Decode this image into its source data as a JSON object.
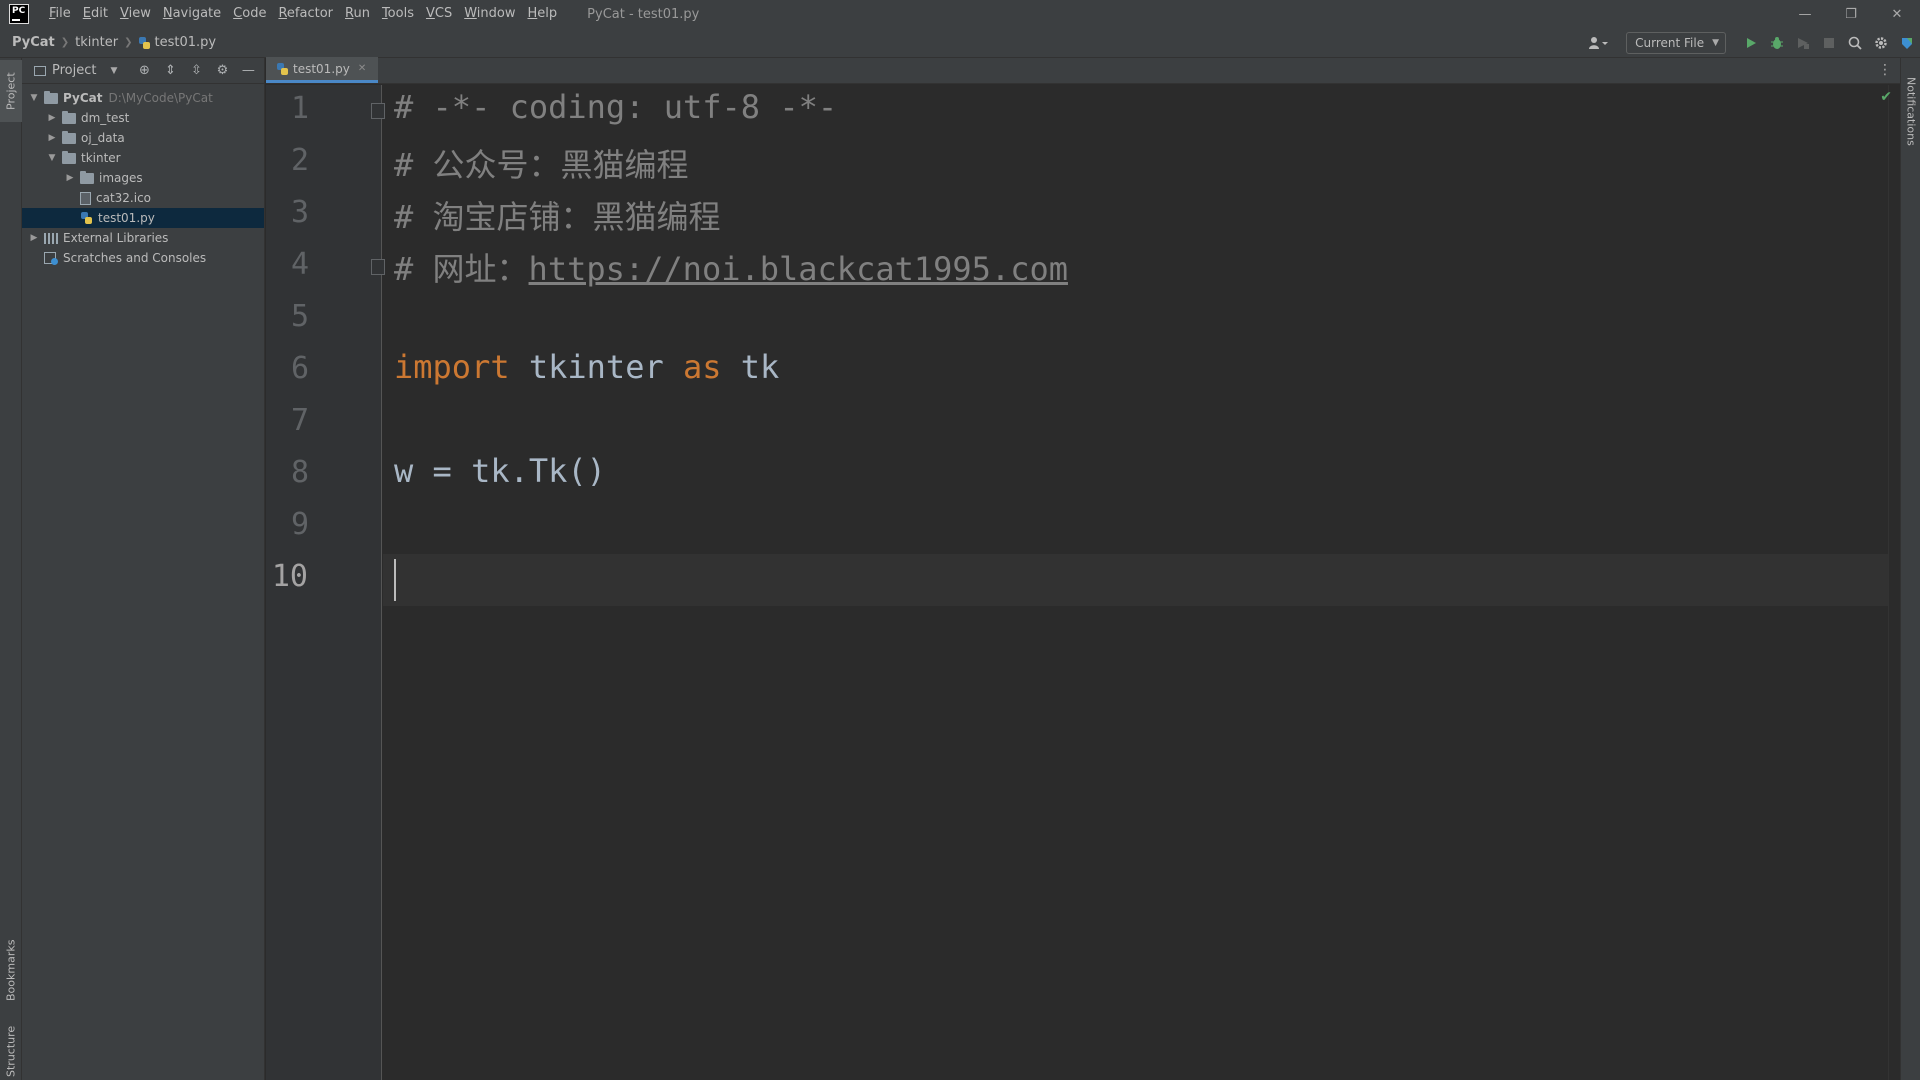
{
  "window": {
    "title": "PyCat - test01.py",
    "logo_text": "PC",
    "minimize": "—",
    "restore": "❐",
    "close": "✕"
  },
  "menu": [
    {
      "label": "File"
    },
    {
      "label": "Edit"
    },
    {
      "label": "View"
    },
    {
      "label": "Navigate"
    },
    {
      "label": "Code"
    },
    {
      "label": "Refactor"
    },
    {
      "label": "Run"
    },
    {
      "label": "Tools"
    },
    {
      "label": "VCS"
    },
    {
      "label": "Window"
    },
    {
      "label": "Help"
    }
  ],
  "breadcrumb": {
    "root": "PyCat",
    "folder": "tkinter",
    "file": "test01.py"
  },
  "toolbar": {
    "run_config": "Current File",
    "icons": [
      "user-icon",
      "run-icon",
      "debug-icon",
      "coverage-icon",
      "stop-icon",
      "search-icon",
      "settings-icon",
      "update-icon"
    ]
  },
  "left_strip": {
    "project": "Project",
    "bookmarks": "Bookmarks",
    "structure": "Structure"
  },
  "right_strip": {
    "notifications": "Notifications"
  },
  "project_panel": {
    "title": "Project",
    "tree": [
      {
        "label": "PyCat",
        "path": "D:\\MyCode\\PyCat"
      },
      {
        "label": "dm_test"
      },
      {
        "label": "oj_data"
      },
      {
        "label": "tkinter"
      },
      {
        "label": "images"
      },
      {
        "label": "cat32.ico"
      },
      {
        "label": "test01.py"
      },
      {
        "label": "External Libraries"
      },
      {
        "label": "Scratches and Consoles"
      }
    ]
  },
  "editor": {
    "tab_label": "test01.py",
    "line_numbers": [
      "1",
      "2",
      "3",
      "4",
      "5",
      "6",
      "7",
      "8",
      "9",
      "10"
    ],
    "lines": {
      "l1": "# -*- coding: utf-8 -*-",
      "l2": "# 公众号：黑猫编程",
      "l3": "# 淘宝店铺：黑猫编程",
      "l4_prefix": "# 网址：",
      "l4_url": "https://noi.blackcat1995.com",
      "l6_kw1": "import",
      "l6_mid": " tkinter ",
      "l6_kw2": "as",
      "l6_end": " tk",
      "l8": "w = tk.Tk()"
    }
  },
  "colors": {
    "accent": "#4a88c7",
    "keyword": "#cc7832",
    "comment": "#808080",
    "code_text": "#a9b7c6",
    "selection": "#0d293e"
  }
}
